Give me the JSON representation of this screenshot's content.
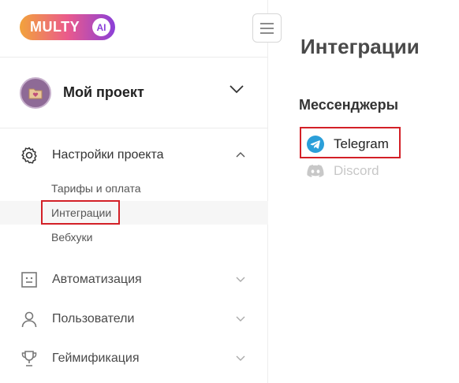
{
  "logo": {
    "text": "MULTY",
    "badge": "AI"
  },
  "project": {
    "name": "Мой проект"
  },
  "sidebar": {
    "settings_label": "Настройки проекта",
    "sub_items": [
      {
        "label": "Тарифы и оплата"
      },
      {
        "label": "Интеграции"
      },
      {
        "label": "Вебхуки"
      }
    ],
    "groups": [
      {
        "label": "Автоматизация",
        "icon": "robot-icon"
      },
      {
        "label": "Пользователи",
        "icon": "user-icon"
      },
      {
        "label": "Геймификация",
        "icon": "trophy-icon"
      }
    ]
  },
  "main": {
    "title": "Интеграции",
    "section_title": "Мессенджеры",
    "messengers": [
      {
        "label": "Telegram",
        "icon": "telegram-icon",
        "color": "#2b9fd9"
      },
      {
        "label": "Discord",
        "icon": "discord-icon",
        "color": "#c8c8c8"
      }
    ]
  },
  "colors": {
    "highlight_border": "#d32027",
    "logo_gradient_start": "#f2a33b",
    "logo_gradient_end": "#8b3fd8"
  }
}
